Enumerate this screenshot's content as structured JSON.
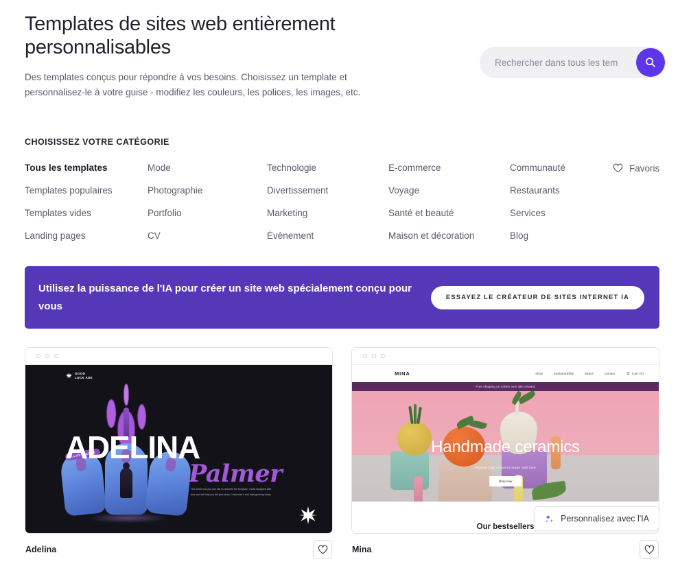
{
  "header": {
    "title": "Templates de sites web entièrement personnalisables",
    "subtitle": "Des templates conçus pour répondre à vos besoins. Choisissez un template et personnalisez-le à votre guise - modifiez les couleurs, les polices, les images, etc."
  },
  "search": {
    "placeholder": "Rechercher dans tous les tem",
    "value": "",
    "icon": "search-icon",
    "button_color": "#5e35e8"
  },
  "categories": {
    "heading": "CHOISISSEZ VOTRE CATÉGORIE",
    "items": [
      "Tous les templates",
      "Mode",
      "Technologie",
      "E-commerce",
      "Communauté",
      "Templates populaires",
      "Photographie",
      "Divertissement",
      "Voyage",
      "Restaurants",
      "Templates vides",
      "Portfolio",
      "Marketing",
      "Santé et beauté",
      "Services",
      "Landing pages",
      "CV",
      "Évènement",
      "Maison et décoration",
      "Blog"
    ],
    "active": "Tous les templates",
    "favorites_label": "Favoris",
    "favorites_icon": "heart-icon"
  },
  "banner": {
    "text": "Utilisez la puissance de l'IA pour créer un site web spécialement conçu pour vous",
    "cta": "ESSAYEZ LE CRÉATEUR DE SITES INTERNET IA",
    "background": "#5538b8"
  },
  "cards": [
    {
      "name": "Adelina",
      "favorite_icon": "heart-icon",
      "preview": {
        "logo": "GOOD\nLUCK ADE",
        "logo_line1": "GOOD",
        "logo_line2": "LUCK ADE",
        "title": "ADELINA",
        "script": "Palmer",
        "badge": "ILLUSTRATOR",
        "body": "This is the text you can use to describe the template. It was designed with love and will help you tell your story. Customize it and start growing today.",
        "background": "#121218"
      }
    },
    {
      "name": "Mina",
      "favorite_icon": "heart-icon",
      "overlay_button": {
        "label": "Personnalisez avec l'IA",
        "icon": "sparkles-icon"
      },
      "preview": {
        "brand": "MINA",
        "nav": [
          "shop",
          "sustainability",
          "about",
          "contact"
        ],
        "cart": "Cart (0)",
        "announcement": "Free shipping on orders over $50 onward",
        "hero_title": "Handmade ceramics",
        "hero_subtitle": "Painted clay ceramics made with love",
        "hero_button": "shop now",
        "bestsellers": "Our bestsellers",
        "announce_color": "#5c2a63"
      }
    }
  ]
}
